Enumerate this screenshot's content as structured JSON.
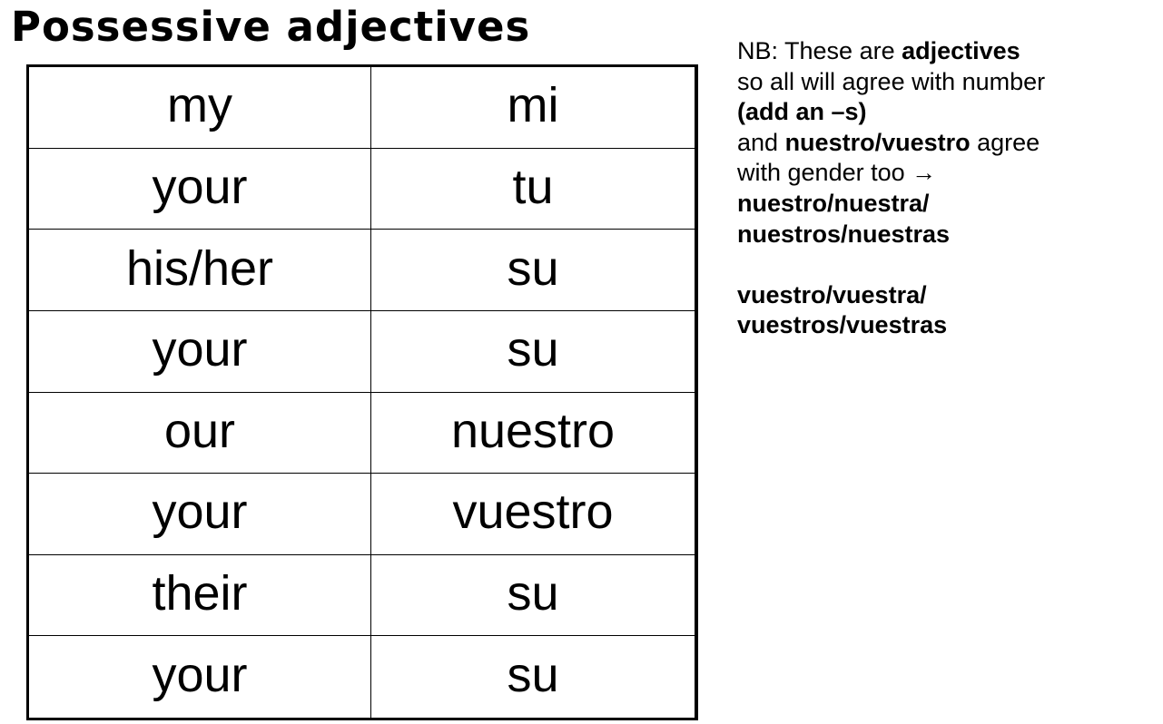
{
  "title": "Possessive adjectives",
  "table": {
    "rows": [
      {
        "english": "my",
        "spanish": "mi"
      },
      {
        "english": "your",
        "spanish": "tu"
      },
      {
        "english": "his/her",
        "spanish": "su"
      },
      {
        "english": "your",
        "spanish": "su"
      },
      {
        "english": "our",
        "spanish": "nuestro"
      },
      {
        "english": "your",
        "spanish": "vuestro"
      },
      {
        "english": "their",
        "spanish": "su"
      },
      {
        "english": "your",
        "spanish": "su"
      }
    ]
  },
  "note": {
    "l1a": "NB:  These are ",
    "l1b": "adjectives",
    "l2": "so all will agree with number",
    "l3": "(add an –s)",
    "l4a": "and ",
    "l4b": "nuestro/vuestro",
    "l4c": " agree",
    "l5": "with gender too →",
    "l6": "nuestro/nuestra/",
    "l7": "nuestros/nuestras",
    "l8": "vuestro/vuestra/",
    "l9": "vuestros/vuestras"
  }
}
